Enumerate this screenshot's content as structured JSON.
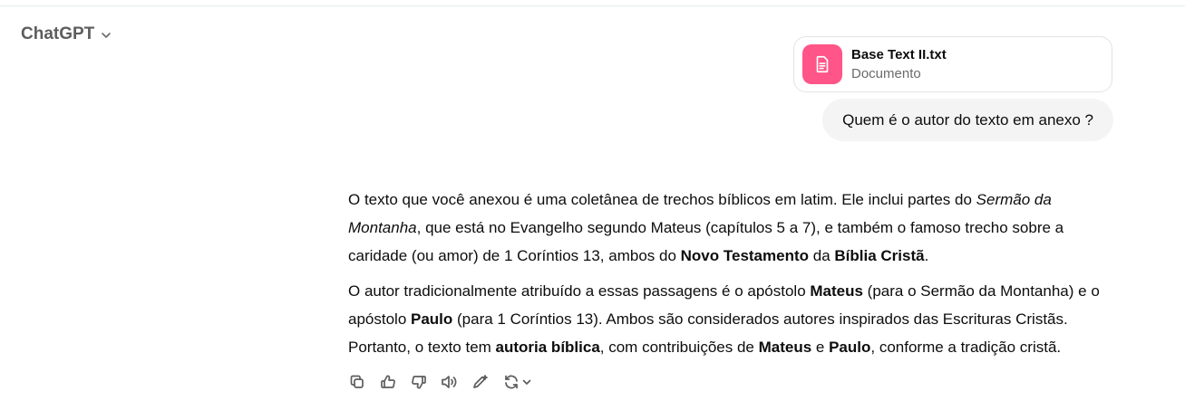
{
  "header": {
    "model_name": "ChatGPT"
  },
  "attachment": {
    "file_name": "Base Text II.txt",
    "file_type": "Documento",
    "icon_color": "#ff5588",
    "icon": "document-icon"
  },
  "user_message": {
    "text": "Quem é o autor do texto em anexo ?"
  },
  "assistant_message": {
    "p1": {
      "t1": "O texto que você anexou é uma coletânea de trechos bíblicos em latim. Ele inclui partes do ",
      "t2": "Sermão da Montanha",
      "t3": ", que está no Evangelho segundo Mateus (capítulos 5 a 7), e também o famoso trecho sobre a caridade (ou amor) de 1 Coríntios 13, ambos do ",
      "t4": "Novo Testamento",
      "t5": " da ",
      "t6": "Bíblia Cristã",
      "t7": "."
    },
    "p2": {
      "t1": "O autor tradicionalmente atribuído a essas passagens é o apóstolo ",
      "t2": "Mateus",
      "t3": " (para o Sermão da Montanha) e o apóstolo ",
      "t4": "Paulo",
      "t5": " (para 1 Coríntios 13). Ambos são considerados autores inspirados das Escrituras Cristãs. Portanto, o texto tem ",
      "t6": "autoria bíblica",
      "t7": ", com contribuições de ",
      "t8": "Mateus",
      "t9": " e ",
      "t10": "Paulo",
      "t11": ", conforme a tradição cristã."
    }
  },
  "actions": [
    "copy-icon",
    "thumbs-up-icon",
    "thumbs-down-icon",
    "read-aloud-icon",
    "edit-icon",
    "regenerate-icon"
  ]
}
